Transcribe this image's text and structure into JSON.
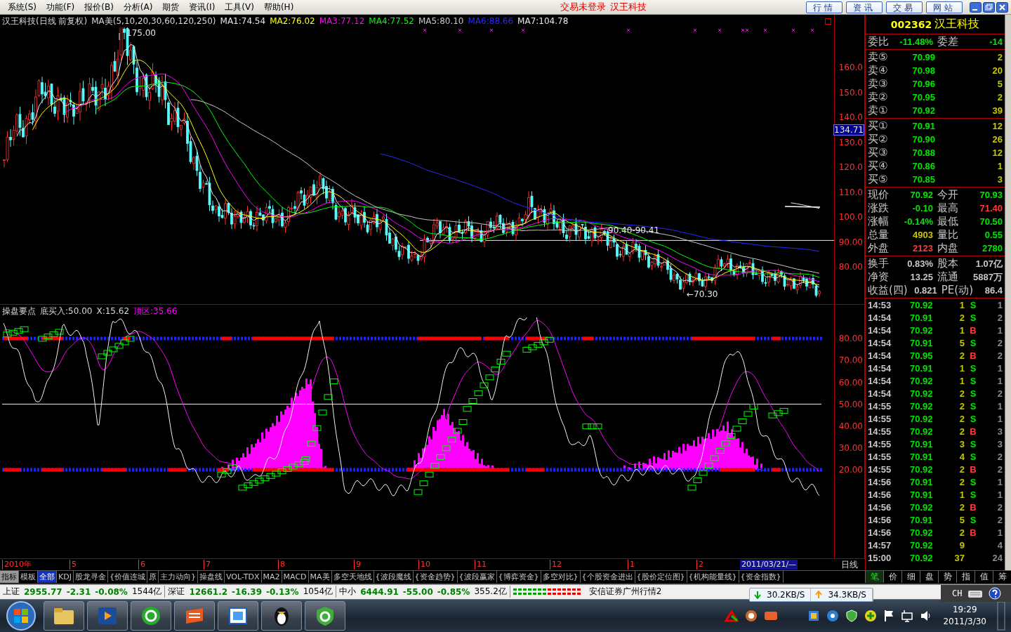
{
  "menu": {
    "items": [
      "系统(S)",
      "功能(F)",
      "报价(B)",
      "分析(A)",
      "期货",
      "资讯(I)",
      "工具(V)",
      "帮助(H)"
    ],
    "login_status": "交易未登录",
    "stock_name": "汉王科技",
    "buttons": [
      "行情",
      "资讯",
      "交易",
      "网站"
    ]
  },
  "chart": {
    "title": "汉王科技(日线 前复权)",
    "ma_label": "MA美(5,10,20,30,60,120,250)",
    "ma_values": [
      {
        "text": "MA1:74.54",
        "color": "#e8e8e8"
      },
      {
        "text": "MA2:76.02",
        "color": "#ffff00"
      },
      {
        "text": "MA3:77.12",
        "color": "#ff00ff"
      },
      {
        "text": "MA4:77.52",
        "color": "#00ff00"
      },
      {
        "text": "MA5:80.10",
        "color": "#c8c8c8"
      },
      {
        "text": "MA6:88.66",
        "color": "#2828ff"
      },
      {
        "text": "MA7:104.78",
        "color": "#e8e8e8"
      }
    ],
    "high_label": "175.00",
    "low_label": "←70.30",
    "range_label": "90.40-90.41",
    "y_ticks": [
      "160.0",
      "150.0",
      "140.0",
      "130.0",
      "120.0",
      "110.0",
      "100.0",
      "90.00",
      "80.00"
    ],
    "cursor_price": "134.71"
  },
  "indicator": {
    "name": "操盘要点",
    "values": [
      {
        "text": "底买入:50.00",
        "color": "#d8d8d8"
      },
      {
        "text": "X:15.62",
        "color": "#d8d8d8"
      },
      {
        "text": "顶区:35.66",
        "color": "#ff00ff"
      }
    ],
    "y_ticks": [
      "80.00",
      "70.00",
      "60.00",
      "50.00",
      "40.00",
      "30.00",
      "20.00"
    ]
  },
  "date_axis": {
    "labels": [
      "2010年",
      "5",
      "6",
      "7",
      "8",
      "9",
      "10",
      "11",
      "12",
      "1",
      "2"
    ],
    "cursor_date": "2011/03/21/—",
    "period": "日线"
  },
  "quote": {
    "code": "002362",
    "name": "汉王科技",
    "ratio": {
      "left": {
        "label": "委比",
        "value": "-11.48%",
        "color": "#00e600"
      },
      "right": {
        "label": "委差",
        "value": "-14",
        "color": "#00e600"
      }
    },
    "asks": [
      {
        "label": "卖⑤",
        "price": "70.99",
        "volume": "2"
      },
      {
        "label": "卖④",
        "price": "70.98",
        "volume": "20"
      },
      {
        "label": "卖③",
        "price": "70.96",
        "volume": "5"
      },
      {
        "label": "卖②",
        "price": "70.95",
        "volume": "2"
      },
      {
        "label": "卖①",
        "price": "70.92",
        "volume": "39"
      }
    ],
    "bids": [
      {
        "label": "买①",
        "price": "70.91",
        "volume": "12"
      },
      {
        "label": "买②",
        "price": "70.90",
        "volume": "26"
      },
      {
        "label": "买③",
        "price": "70.88",
        "volume": "12"
      },
      {
        "label": "买④",
        "price": "70.86",
        "volume": "1"
      },
      {
        "label": "买⑤",
        "price": "70.85",
        "volume": "3"
      }
    ],
    "stats": [
      {
        "left": {
          "label": "现价",
          "value": "70.92",
          "color": "#00e600"
        },
        "right": {
          "label": "今开",
          "value": "70.93",
          "color": "#00e600"
        }
      },
      {
        "left": {
          "label": "涨跌",
          "value": "-0.10",
          "color": "#00e600"
        },
        "right": {
          "label": "最高",
          "value": "71.40",
          "color": "#ff3c3c"
        }
      },
      {
        "left": {
          "label": "涨幅",
          "value": "-0.14%",
          "color": "#00e600"
        },
        "right": {
          "label": "最低",
          "value": "70.50",
          "color": "#00e600"
        }
      },
      {
        "left": {
          "label": "总量",
          "value": "4903",
          "color": "#c8c800"
        },
        "right": {
          "label": "量比",
          "value": "0.55",
          "color": "#00e600"
        }
      },
      {
        "left": {
          "label": "外盘",
          "value": "2123",
          "color": "#ff3c3c"
        },
        "right": {
          "label": "内盘",
          "value": "2780",
          "color": "#00e600"
        }
      }
    ],
    "finance": [
      {
        "left": {
          "label": "换手",
          "value": "0.83%",
          "color": "#c8c8c8"
        },
        "right": {
          "label": "股本",
          "value": "1.07亿",
          "color": "#c8c8c8"
        }
      },
      {
        "left": {
          "label": "净资",
          "value": "13.25",
          "color": "#c8c8c8"
        },
        "right": {
          "label": "流通",
          "value": "5887万",
          "color": "#c8c8c8"
        }
      },
      {
        "left": {
          "label": "收益(四)",
          "value": "0.821",
          "color": "#c8c8c8"
        },
        "right": {
          "label": "PE(动)",
          "value": "86.4",
          "color": "#c8c8c8"
        }
      }
    ]
  },
  "trades": [
    {
      "time": "14:53",
      "price": "70.92",
      "volume": "1",
      "side": "S",
      "buy": false,
      "count": "1"
    },
    {
      "time": "14:54",
      "price": "70.91",
      "volume": "2",
      "side": "S",
      "buy": false,
      "count": "2"
    },
    {
      "time": "14:54",
      "price": "70.92",
      "volume": "1",
      "side": "B",
      "buy": true,
      "count": "1"
    },
    {
      "time": "14:54",
      "price": "70.91",
      "volume": "5",
      "side": "S",
      "buy": false,
      "count": "2"
    },
    {
      "time": "14:54",
      "price": "70.95",
      "volume": "2",
      "side": "B",
      "buy": true,
      "count": "2"
    },
    {
      "time": "14:54",
      "price": "70.91",
      "volume": "1",
      "side": "S",
      "buy": false,
      "count": "1"
    },
    {
      "time": "14:54",
      "price": "70.92",
      "volume": "1",
      "side": "S",
      "buy": false,
      "count": "1"
    },
    {
      "time": "14:54",
      "price": "70.92",
      "volume": "2",
      "side": "S",
      "buy": false,
      "count": "2"
    },
    {
      "time": "14:55",
      "price": "70.92",
      "volume": "2",
      "side": "S",
      "buy": false,
      "count": "1"
    },
    {
      "time": "14:55",
      "price": "70.92",
      "volume": "2",
      "side": "S",
      "buy": false,
      "count": "1"
    },
    {
      "time": "14:55",
      "price": "70.92",
      "volume": "2",
      "side": "B",
      "buy": true,
      "count": "3"
    },
    {
      "time": "14:55",
      "price": "70.91",
      "volume": "3",
      "side": "S",
      "buy": false,
      "count": "3"
    },
    {
      "time": "14:55",
      "price": "70.91",
      "volume": "4",
      "side": "S",
      "buy": false,
      "count": "2"
    },
    {
      "time": "14:55",
      "price": "70.92",
      "volume": "2",
      "side": "B",
      "buy": true,
      "count": "2"
    },
    {
      "time": "14:56",
      "price": "70.91",
      "volume": "2",
      "side": "S",
      "buy": false,
      "count": "1"
    },
    {
      "time": "14:56",
      "price": "70.91",
      "volume": "1",
      "side": "S",
      "buy": false,
      "count": "1"
    },
    {
      "time": "14:56",
      "price": "70.92",
      "volume": "2",
      "side": "B",
      "buy": true,
      "count": "2"
    },
    {
      "time": "14:56",
      "price": "70.91",
      "volume": "5",
      "side": "S",
      "buy": false,
      "count": "2"
    },
    {
      "time": "14:56",
      "price": "70.92",
      "volume": "2",
      "side": "B",
      "buy": true,
      "count": "1"
    },
    {
      "time": "14:57",
      "price": "70.92",
      "volume": "9",
      "count": "4"
    },
    {
      "time": "15:00",
      "price": "70.92",
      "volume": "37",
      "count": "24"
    }
  ],
  "bottom_tabs": [
    {
      "label": "指标",
      "kind": "button",
      "selected": false
    },
    {
      "label": "模板",
      "kind": "tab",
      "selected": false
    },
    {
      "label": "全部",
      "kind": "tab",
      "selected": true
    },
    {
      "label": "KDJ",
      "kind": "tab",
      "selected": false
    },
    {
      "label": "股龙寻金",
      "kind": "tab",
      "selected": false
    },
    {
      "label": "{价值连城",
      "kind": "tab",
      "selected": false
    },
    {
      "label": "原",
      "kind": "tab",
      "selected": false
    },
    {
      "label": "主力动向}",
      "kind": "tab",
      "selected": false
    },
    {
      "label": "操盘线",
      "kind": "tab",
      "selected": false
    },
    {
      "label": "VOL-TDX",
      "kind": "tab",
      "selected": false
    },
    {
      "label": "MA2",
      "kind": "tab",
      "selected": false
    },
    {
      "label": "MACD",
      "kind": "tab",
      "selected": false
    },
    {
      "label": "MA美",
      "kind": "tab",
      "selected": false
    },
    {
      "label": "多空天地线",
      "kind": "tab",
      "selected": false
    },
    {
      "label": "{波段魔线",
      "kind": "tab",
      "selected": false
    },
    {
      "label": "{资金趋势}",
      "kind": "tab",
      "selected": false
    },
    {
      "label": "{波段赢家",
      "kind": "tab",
      "selected": false
    },
    {
      "label": "{博弈资金}",
      "kind": "tab",
      "selected": false
    },
    {
      "label": "多空对比}",
      "kind": "tab",
      "selected": false
    },
    {
      "label": "{个股资金进出",
      "kind": "tab",
      "selected": false
    },
    {
      "label": "{股价定位图}",
      "kind": "tab",
      "selected": false
    },
    {
      "label": "{机构能量线}",
      "kind": "tab",
      "selected": false
    },
    {
      "label": "{资金指数}",
      "kind": "tab",
      "selected": false
    }
  ],
  "panel_tabs": [
    {
      "label": "笔",
      "selected": true
    },
    {
      "label": "价",
      "selected": false
    },
    {
      "label": "细",
      "selected": false
    },
    {
      "label": "盘",
      "selected": false
    },
    {
      "label": "势",
      "selected": false
    },
    {
      "label": "指",
      "selected": false
    },
    {
      "label": "值",
      "selected": false
    },
    {
      "label": "筹",
      "selected": false
    }
  ],
  "status_bar": {
    "indices": [
      {
        "name": "上证",
        "value": "2955.77",
        "change": "-2.31",
        "percent": "-0.08%",
        "amount": "1544亿"
      },
      {
        "name": "深证",
        "value": "12661.2",
        "change": "-16.39",
        "percent": "-0.13%",
        "amount": "1054亿"
      },
      {
        "name": "中小",
        "value": "6444.91",
        "change": "-55.00",
        "percent": "-0.85%",
        "amount": "355.2亿"
      }
    ],
    "server": "安信证券广州行情2",
    "download": "30.2KB/S",
    "upload": "34.3KB/S",
    "language": "CH"
  },
  "taskbar": {
    "time": "19:29",
    "date": "2011/3/30"
  }
}
